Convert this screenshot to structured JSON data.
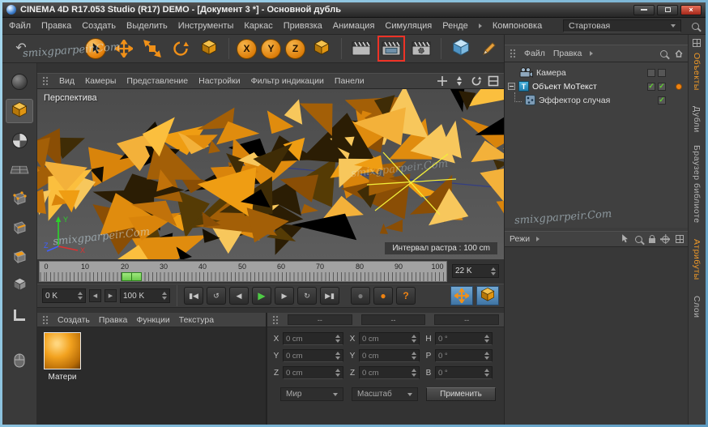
{
  "window": {
    "title": "CINEMA 4D R17.053 Studio (R17) DEMO - [Документ 3 *] - Основной дубль"
  },
  "menubar": {
    "items": [
      "Файл",
      "Правка",
      "Создать",
      "Выделить",
      "Инструменты",
      "Каркас",
      "Привязка",
      "Анимация",
      "Симуляция",
      "Ренде",
      "Компоновка"
    ],
    "layout_preset": "Стартовая"
  },
  "toolbar": {
    "axis_x": "X",
    "axis_y": "Y",
    "axis_z": "Z"
  },
  "viewport": {
    "menu_items": [
      "Вид",
      "Камеры",
      "Представление",
      "Настройки",
      "Фильтр индикации",
      "Панели"
    ],
    "camera_label": "Перспектива",
    "raster_label": "Интервал растра : 100 cm",
    "axis_labels": {
      "x": "X",
      "y": "Y",
      "z": "Z"
    }
  },
  "timeline": {
    "tick_labels": [
      "0",
      "10",
      "20",
      "30",
      "40",
      "50",
      "60",
      "70",
      "80",
      "90",
      "100"
    ],
    "frame_field": "22 K",
    "current_frame": 22
  },
  "transport": {
    "start_value": "0 K",
    "end_value": "100 K",
    "glyphs": [
      "▮◀",
      "↺",
      "◀",
      "▶",
      "▶",
      "↻",
      "▶▮"
    ],
    "record_glyph": "●",
    "help_glyph": "?"
  },
  "materials": {
    "menu_items": [
      "Создать",
      "Правка",
      "Функции",
      "Текстура"
    ],
    "first_material": "Матери"
  },
  "coordinates": {
    "headers": [
      "--",
      "--",
      "--"
    ],
    "position": {
      "labels": [
        "X",
        "Y",
        "Z"
      ],
      "values": [
        "0 cm",
        "0 cm",
        "0 cm"
      ]
    },
    "scale": {
      "labels": [
        "X",
        "Y",
        "Z"
      ],
      "values": [
        "0 cm",
        "0 cm",
        "0 cm"
      ]
    },
    "rotation": {
      "labels": [
        "H",
        "P",
        "B"
      ],
      "values": [
        "0 °",
        "0 °",
        "0 °"
      ]
    },
    "space_dropdown": "Мир",
    "mode_dropdown": "Масштаб",
    "apply_button": "Применить"
  },
  "object_manager": {
    "menu_items": [
      "Файл",
      "Правка"
    ],
    "motext_glyph": "T",
    "items": [
      {
        "label": "Камера"
      },
      {
        "label": "Объект МоТекст"
      },
      {
        "label": "Эффектор случая"
      }
    ]
  },
  "attributes_panel": {
    "menu_label": "Режи"
  },
  "right_tabs": {
    "objects": "Объекты",
    "takes": "Дубли",
    "browser": "Браузер библиоте",
    "attributes": "Атрибуты",
    "layers": "Слои"
  },
  "watermark": "smixgparpeir.Com",
  "colors": {
    "accent_orange": "#ee8c0e",
    "highlight_red": "#ee3226",
    "check_green": "#62d22f",
    "play_green": "#4ecb45",
    "marker_green": "#7ee05a",
    "autokey_blue": "#4f7fae"
  }
}
